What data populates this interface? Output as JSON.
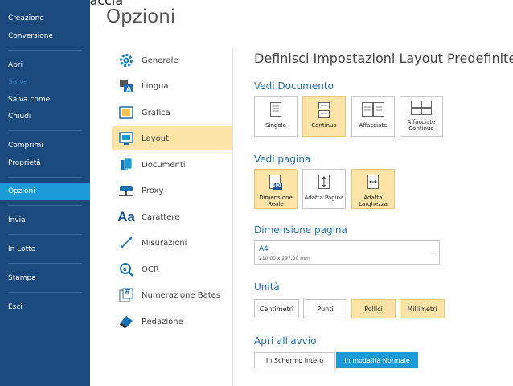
{
  "window": {
    "title": "Vecchia interfaccia"
  },
  "sidebar": {
    "items": [
      {
        "label": "Creazione"
      },
      {
        "label": "Conversione"
      },
      {
        "label": "Apri"
      },
      {
        "label": "Salva"
      },
      {
        "label": "Salva come"
      },
      {
        "label": "Chiudi"
      },
      {
        "label": "Comprimi"
      },
      {
        "label": "Proprietà"
      },
      {
        "label": "Opzioni"
      },
      {
        "label": "Invia"
      },
      {
        "label": "In Lotto"
      },
      {
        "label": "Stampa"
      },
      {
        "label": "Esci"
      }
    ]
  },
  "page_title": "Opzioni",
  "categories": [
    {
      "label": "Generale",
      "icon": "gear-icon"
    },
    {
      "label": "Lingua",
      "icon": "language-icon"
    },
    {
      "label": "Grafica",
      "icon": "graphics-icon"
    },
    {
      "label": "Layout",
      "icon": "layout-icon"
    },
    {
      "label": "Documenti",
      "icon": "documents-icon"
    },
    {
      "label": "Proxy",
      "icon": "proxy-icon"
    },
    {
      "label": "Carattere",
      "icon": "font-icon",
      "glyph": "Aa"
    },
    {
      "label": "Misurazioni",
      "icon": "ruler-icon"
    },
    {
      "label": "OCR",
      "icon": "ocr-icon"
    },
    {
      "label": "Numerazione Bates",
      "icon": "bates-icon",
      "glyph": "#"
    },
    {
      "label": "Redazione",
      "icon": "eraser-icon"
    }
  ],
  "panel": {
    "title": "Definisci Impostazioni Layout Predefinite",
    "view_document": {
      "title": "Vedi Documento",
      "options": [
        {
          "label": "Singola"
        },
        {
          "label": "Continuo"
        },
        {
          "label": "Affacciate"
        },
        {
          "label": "Affacciate Continuo"
        }
      ]
    },
    "view_page": {
      "title": "Vedi pagina",
      "options": [
        {
          "label": "Dimensione Reale",
          "badge": "100"
        },
        {
          "label": "Adatta Pagina"
        },
        {
          "label": "Adatta Larghezza"
        }
      ]
    },
    "page_size": {
      "title": "Dimensione pagina",
      "value": "A4",
      "sub": "210.00 x 297.00 mm",
      "arrow": "⌄"
    },
    "units": {
      "title": "Unità",
      "options": [
        {
          "label": "Centimetri"
        },
        {
          "label": "Punti"
        },
        {
          "label": "Pollici"
        },
        {
          "label": "Millimetri"
        }
      ]
    },
    "open_at_start": {
      "title": "Apri all'avvio",
      "options": [
        {
          "label": "In Schermo intero"
        },
        {
          "label": "In modalità Normale"
        }
      ]
    }
  },
  "colors": {
    "sidebar_bg": "#19497d",
    "accent_blue": "#1a9ad7",
    "selected_fill": "#fde3a7",
    "section_title": "#1a6fb4"
  }
}
